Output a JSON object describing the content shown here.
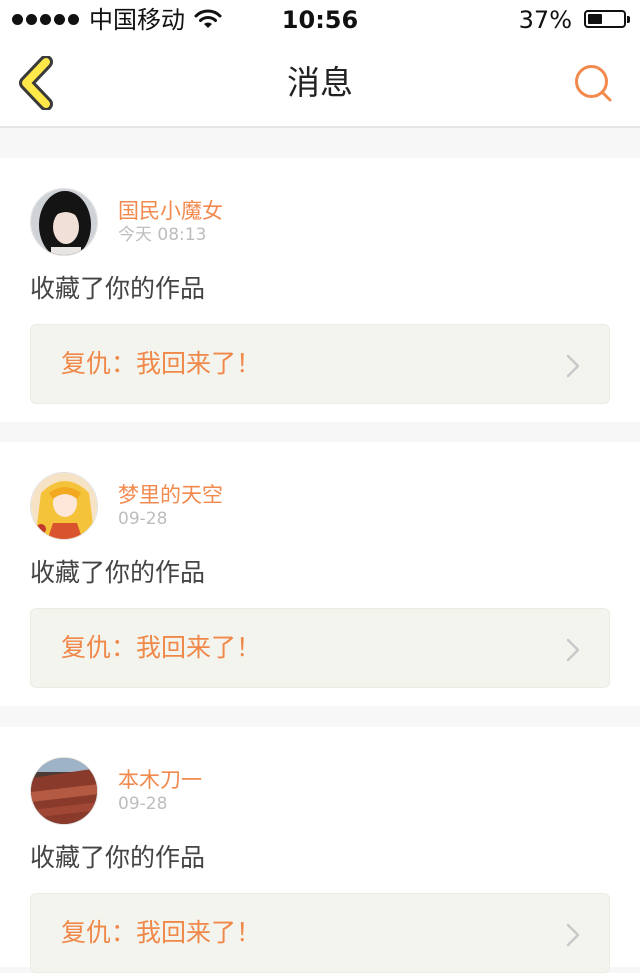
{
  "status_bar": {
    "carrier": "中国移动",
    "time": "10:56",
    "battery_percent": "37%",
    "battery_level": 0.37
  },
  "navbar": {
    "title": "消息",
    "back_icon": "chevron-left-icon",
    "search_icon": "search-icon"
  },
  "colors": {
    "accent": "#f28a4e",
    "back_icon_fill": "#ffe84a",
    "back_icon_stroke": "#3a3a3a",
    "card_bg": "#ffffff",
    "link_bg": "#f4f4ee",
    "page_bg": "#f7f7f7"
  },
  "messages": [
    {
      "username": "国民小魔女",
      "time": "今天 08:13",
      "action": "收藏了你的作品",
      "work_title": "复仇：我回来了！"
    },
    {
      "username": "梦里的天空",
      "time": "09-28",
      "action": "收藏了你的作品",
      "work_title": "复仇：我回来了！"
    },
    {
      "username": "本木刀一",
      "time": "09-28",
      "action": "收藏了你的作品",
      "work_title": "复仇：我回来了！"
    }
  ]
}
